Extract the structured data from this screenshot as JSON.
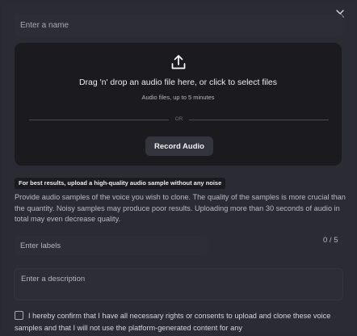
{
  "name_input": {
    "placeholder": "Enter a name"
  },
  "dropzone": {
    "icon": "upload-icon",
    "title": "Drag 'n' drop an audio file here, or click to select files",
    "subtitle": "Audio files, up to 5 minutes",
    "divider_text": "OR",
    "record_button": "Record Audio"
  },
  "tip": "For best results, upload a high-quality audio sample without any noise",
  "description": "Provide audio samples of the voice you wish to clone. The quality of the samples is more crucial than the quantity. Noisy samples may produce poor results. Uploading more than 30 seconds of audio in total may even decrease quality.",
  "labels": {
    "placeholder": "Enter labels",
    "count": "0 / 5"
  },
  "description_input": {
    "placeholder": "Enter a description"
  },
  "consent": {
    "checked": false,
    "text": "I hereby confirm that I have all necessary rights or consents to upload and clone these voice samples and that I will not use the platform-generated content for any"
  },
  "colors": {
    "modal_bg": "#2a2b33",
    "dropzone_bg": "#1b1b1f",
    "button_bg": "#34353c"
  }
}
